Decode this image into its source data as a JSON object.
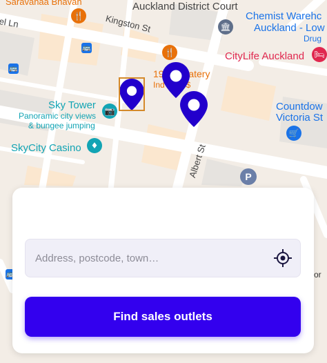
{
  "map": {
    "labels": {
      "saravanaa": "Saravanaa Bhavan",
      "kingston_st": "Kingston St",
      "auckland_district_court": "Auckland District Court",
      "chemist_line1": "Chemist Warehc",
      "chemist_line2": "Auckland - Low",
      "chemist_line3": "Drug",
      "el_ln": "el Ln",
      "citylife": "CityLife Auckland",
      "eatery_line1": "19",
      "eatery_line1b": "Eatery",
      "eatery_line2": "Ind",
      "eatery_line2b": "$$",
      "sky_tower": "Sky Tower",
      "sky_tower_sub1": "Panoramic city views",
      "sky_tower_sub2": "& bungee jumping",
      "skycity_casino": "SkyCity Casino",
      "countdown_line1": "Countdow",
      "countdown_line2": "Victoria St",
      "albert_st": "Albert St",
      "edge_text": "or"
    },
    "parking_letter": "P"
  },
  "search": {
    "placeholder": "Address, postcode, town…",
    "value": ""
  },
  "find_button": {
    "label": "Find sales outlets"
  },
  "colors": {
    "accent": "#3300ee",
    "pin": "#2200cc",
    "selected_outline": "#d4892a",
    "food_poi": "#e8710a",
    "landmark_poi": "#12a4b4",
    "civic_poi": "#5f6f8a",
    "shop_poi": "#1a73e8",
    "hotel_poi": "#e0284f"
  }
}
